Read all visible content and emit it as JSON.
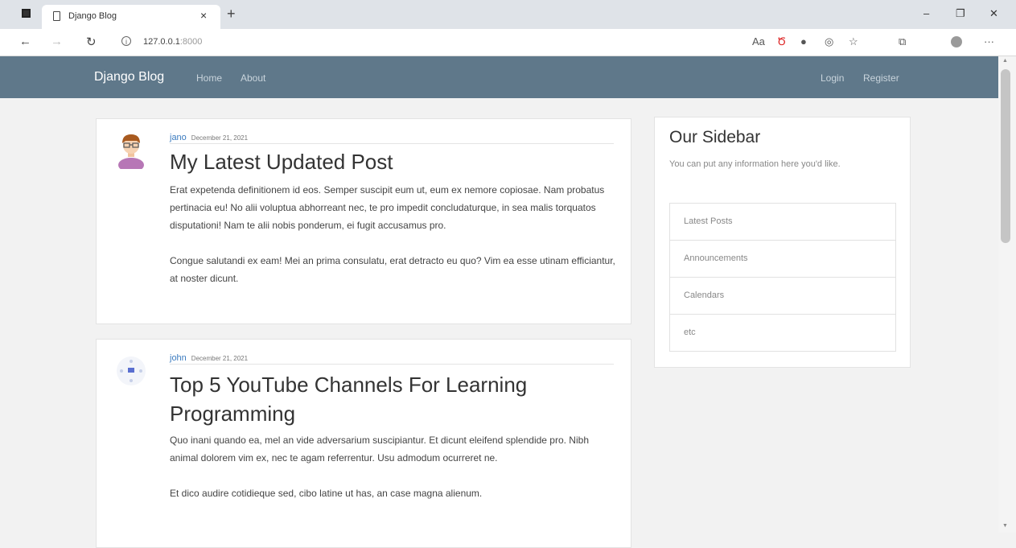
{
  "browser": {
    "tab_title": "Django Blog",
    "tab_close": "×",
    "new_tab": "+",
    "url_host": "127.0.0.1",
    "url_port": ":8000",
    "info": "i",
    "win_minimize": "–",
    "win_restore": "❐",
    "win_close": "✕",
    "back": "←",
    "forward": "→",
    "reload": "↻",
    "more": "···"
  },
  "site": {
    "brand": "Django Blog",
    "nav_left": [
      "Home",
      "About"
    ],
    "nav_right": [
      "Login",
      "Register"
    ]
  },
  "posts": [
    {
      "author": "jano",
      "date": "December 21, 2021",
      "title": "My Latest Updated Post",
      "paragraphs": [
        "Erat expetenda definitionem id eos. Semper suscipit eum ut, eum ex nemore copiosae. Nam probatus pertinacia eu! No alii voluptua abhorreant nec, te pro impedit concludaturque, in sea malis torquatos disputationi! Nam te alii nobis ponderum, ei fugit accusamus pro.",
        "Congue salutandi ex eam! Mei an prima consulatu, erat detracto eu quo? Vim ea esse utinam efficiantur, at noster dicunt."
      ]
    },
    {
      "author": "john",
      "date": "December 21, 2021",
      "title": "Top 5 YouTube Channels For Learning Programming",
      "paragraphs": [
        "Quo inani quando ea, mel an vide adversarium suscipiantur. Et dicunt eleifend splendide pro. Nibh animal dolorem vim ex, nec te agam referrentur. Usu admodum ocurreret ne.",
        "Et dico audire cotidieque sed, cibo latine ut has, an case magna alienum."
      ]
    }
  ],
  "sidebar": {
    "title": "Our Sidebar",
    "text": "You can put any information here you'd like.",
    "items": [
      "Latest Posts",
      "Announcements",
      "Calendars",
      "etc"
    ]
  },
  "colors": {
    "navbar": "#5f788a",
    "link": "#3b7bbf"
  }
}
